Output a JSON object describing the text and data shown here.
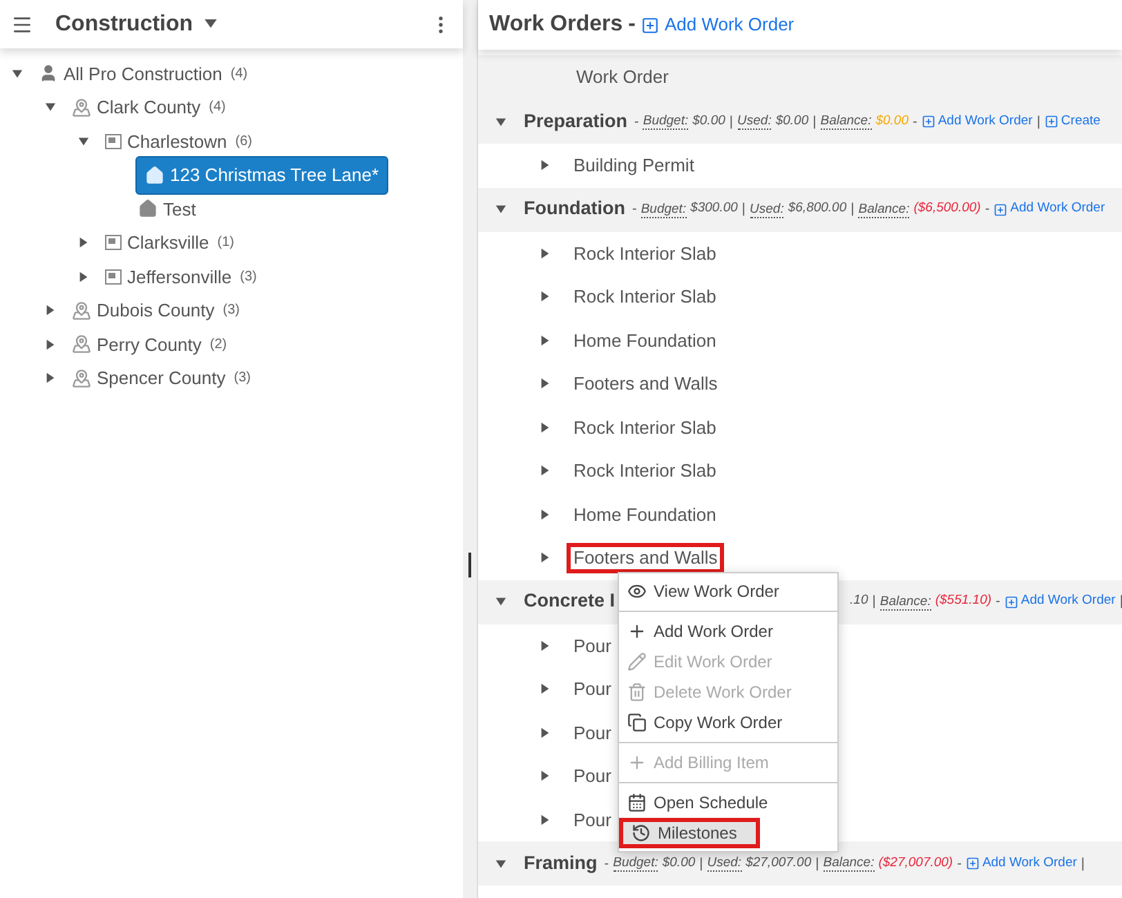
{
  "sidebar": {
    "title": "Construction",
    "tree": [
      {
        "kind": "company",
        "label": "All Pro Construction",
        "count": "(4)",
        "expanded": true,
        "selected": false,
        "children": [
          {
            "kind": "region",
            "label": "Clark County",
            "count": "(4)",
            "expanded": true,
            "selected": false,
            "children": [
              {
                "kind": "city",
                "label": "Charlestown",
                "count": "(6)",
                "expanded": true,
                "selected": false,
                "children": [
                  {
                    "kind": "house",
                    "label": "123 Christmas Tree Lane*",
                    "selected": true
                  },
                  {
                    "kind": "house",
                    "label": "Test",
                    "selected": false
                  }
                ]
              },
              {
                "kind": "city",
                "label": "Clarksville",
                "count": "(1)",
                "expanded": false,
                "selected": false
              },
              {
                "kind": "city",
                "label": "Jeffersonville",
                "count": "(3)",
                "expanded": false,
                "selected": false
              }
            ]
          },
          {
            "kind": "region",
            "label": "Dubois County",
            "count": "(3)",
            "expanded": false,
            "selected": false
          },
          {
            "kind": "region",
            "label": "Perry County",
            "count": "(2)",
            "expanded": false,
            "selected": false
          },
          {
            "kind": "region",
            "label": "Spencer County",
            "count": "(3)",
            "expanded": false,
            "selected": false
          }
        ]
      }
    ]
  },
  "main": {
    "title": "Work Orders",
    "dash": "-",
    "add_link": "Add Work Order",
    "column_header": "Work Order",
    "groups": [
      {
        "title": "Preparation",
        "kind": "plain",
        "meta": [
          {
            "kind": "text",
            "text": "-"
          },
          {
            "kind": "label",
            "text": "Budget:"
          },
          {
            "kind": "value",
            "text": "$0.00"
          },
          {
            "kind": "text",
            "text": "|"
          },
          {
            "kind": "label",
            "text": "Used:"
          },
          {
            "kind": "value",
            "text": "$0.00"
          },
          {
            "kind": "text",
            "text": "|"
          },
          {
            "kind": "label",
            "text": "Balance:"
          },
          {
            "kind": "value",
            "text": "$0.00",
            "color": "#f5a800"
          },
          {
            "kind": "text",
            "text": "-"
          },
          {
            "kind": "link",
            "text": "Add Work Order"
          },
          {
            "kind": "text",
            "text": "|"
          },
          {
            "kind": "link",
            "text": "Create"
          }
        ],
        "items": [
          {
            "label": "Building Permit",
            "highlighted": false
          }
        ]
      },
      {
        "title": "Foundation",
        "kind": "plain",
        "meta": [
          {
            "kind": "text",
            "text": "-"
          },
          {
            "kind": "label",
            "text": "Budget:"
          },
          {
            "kind": "value",
            "text": "$300.00"
          },
          {
            "kind": "text",
            "text": "|"
          },
          {
            "kind": "label",
            "text": "Used:"
          },
          {
            "kind": "value",
            "text": "$6,800.00"
          },
          {
            "kind": "text",
            "text": "|"
          },
          {
            "kind": "label",
            "text": "Balance:"
          },
          {
            "kind": "value",
            "text": "($6,500.00)",
            "color": "#e8253a"
          },
          {
            "kind": "text",
            "text": "-"
          },
          {
            "kind": "link",
            "text": "Add Work Order"
          }
        ],
        "items": [
          {
            "label": "Rock Interior Slab",
            "highlighted": false
          },
          {
            "label": "Rock Interior Slab",
            "highlighted": false
          },
          {
            "label": "Home Foundation",
            "highlighted": false
          },
          {
            "label": "Footers and Walls",
            "highlighted": false
          },
          {
            "label": "Rock Interior Slab",
            "highlighted": false
          },
          {
            "label": "Rock Interior Slab",
            "highlighted": false
          },
          {
            "label": "Home Foundation",
            "highlighted": false
          },
          {
            "label": "Footers and Walls",
            "highlighted": true
          }
        ]
      },
      {
        "title": "Concrete I",
        "kind": "covered",
        "meta": [
          {
            "kind": "value",
            "text": ".10"
          },
          {
            "kind": "text",
            "text": "|"
          },
          {
            "kind": "label",
            "text": "Balance:"
          },
          {
            "kind": "value",
            "text": "($551.10)",
            "color": "#e8253a"
          },
          {
            "kind": "text",
            "text": "-"
          },
          {
            "kind": "link",
            "text": "Add Work Order"
          },
          {
            "kind": "text",
            "text": "|"
          }
        ],
        "items": [
          {
            "label": "Pour",
            "highlighted": false
          },
          {
            "label": "Pour",
            "highlighted": false
          },
          {
            "label": "Pour",
            "highlighted": false
          },
          {
            "label": "Pour",
            "highlighted": false
          },
          {
            "label": "Pour",
            "highlighted": false
          }
        ]
      },
      {
        "title": "Framing",
        "kind": "plain",
        "meta": [
          {
            "kind": "text",
            "text": "-"
          },
          {
            "kind": "label",
            "text": "Budget:"
          },
          {
            "kind": "value",
            "text": "$0.00"
          },
          {
            "kind": "text",
            "text": "|"
          },
          {
            "kind": "label",
            "text": "Used:"
          },
          {
            "kind": "value",
            "text": "$27,007.00"
          },
          {
            "kind": "text",
            "text": "|"
          },
          {
            "kind": "label",
            "text": "Balance:"
          },
          {
            "kind": "value",
            "text": "($27,007.00)",
            "color": "#e8253a"
          },
          {
            "kind": "text",
            "text": "-"
          },
          {
            "kind": "link",
            "text": "Add Work Order"
          },
          {
            "kind": "text",
            "text": "|"
          }
        ]
      }
    ]
  },
  "context_menu": [
    {
      "kind": "eye",
      "label": "View Work Order",
      "disabled": false,
      "selected": false,
      "highlighted": false
    },
    {
      "kind": "separator"
    },
    {
      "kind": "plus",
      "label": "Add Work Order",
      "disabled": false,
      "selected": false,
      "highlighted": false
    },
    {
      "kind": "pencil",
      "label": "Edit Work Order",
      "disabled": true,
      "selected": false,
      "highlighted": false
    },
    {
      "kind": "trash",
      "label": "Delete Work Order",
      "disabled": true,
      "selected": false,
      "highlighted": false
    },
    {
      "kind": "copy",
      "label": "Copy Work Order",
      "disabled": false,
      "selected": false,
      "highlighted": false
    },
    {
      "kind": "separator"
    },
    {
      "kind": "plus",
      "label": "Add Billing Item",
      "disabled": true,
      "selected": false,
      "highlighted": false
    },
    {
      "kind": "separator"
    },
    {
      "kind": "calendar",
      "label": "Open Schedule",
      "disabled": false,
      "selected": false,
      "highlighted": false
    },
    {
      "kind": "history",
      "label": "Milestones",
      "disabled": false,
      "selected": true,
      "highlighted": true
    }
  ]
}
